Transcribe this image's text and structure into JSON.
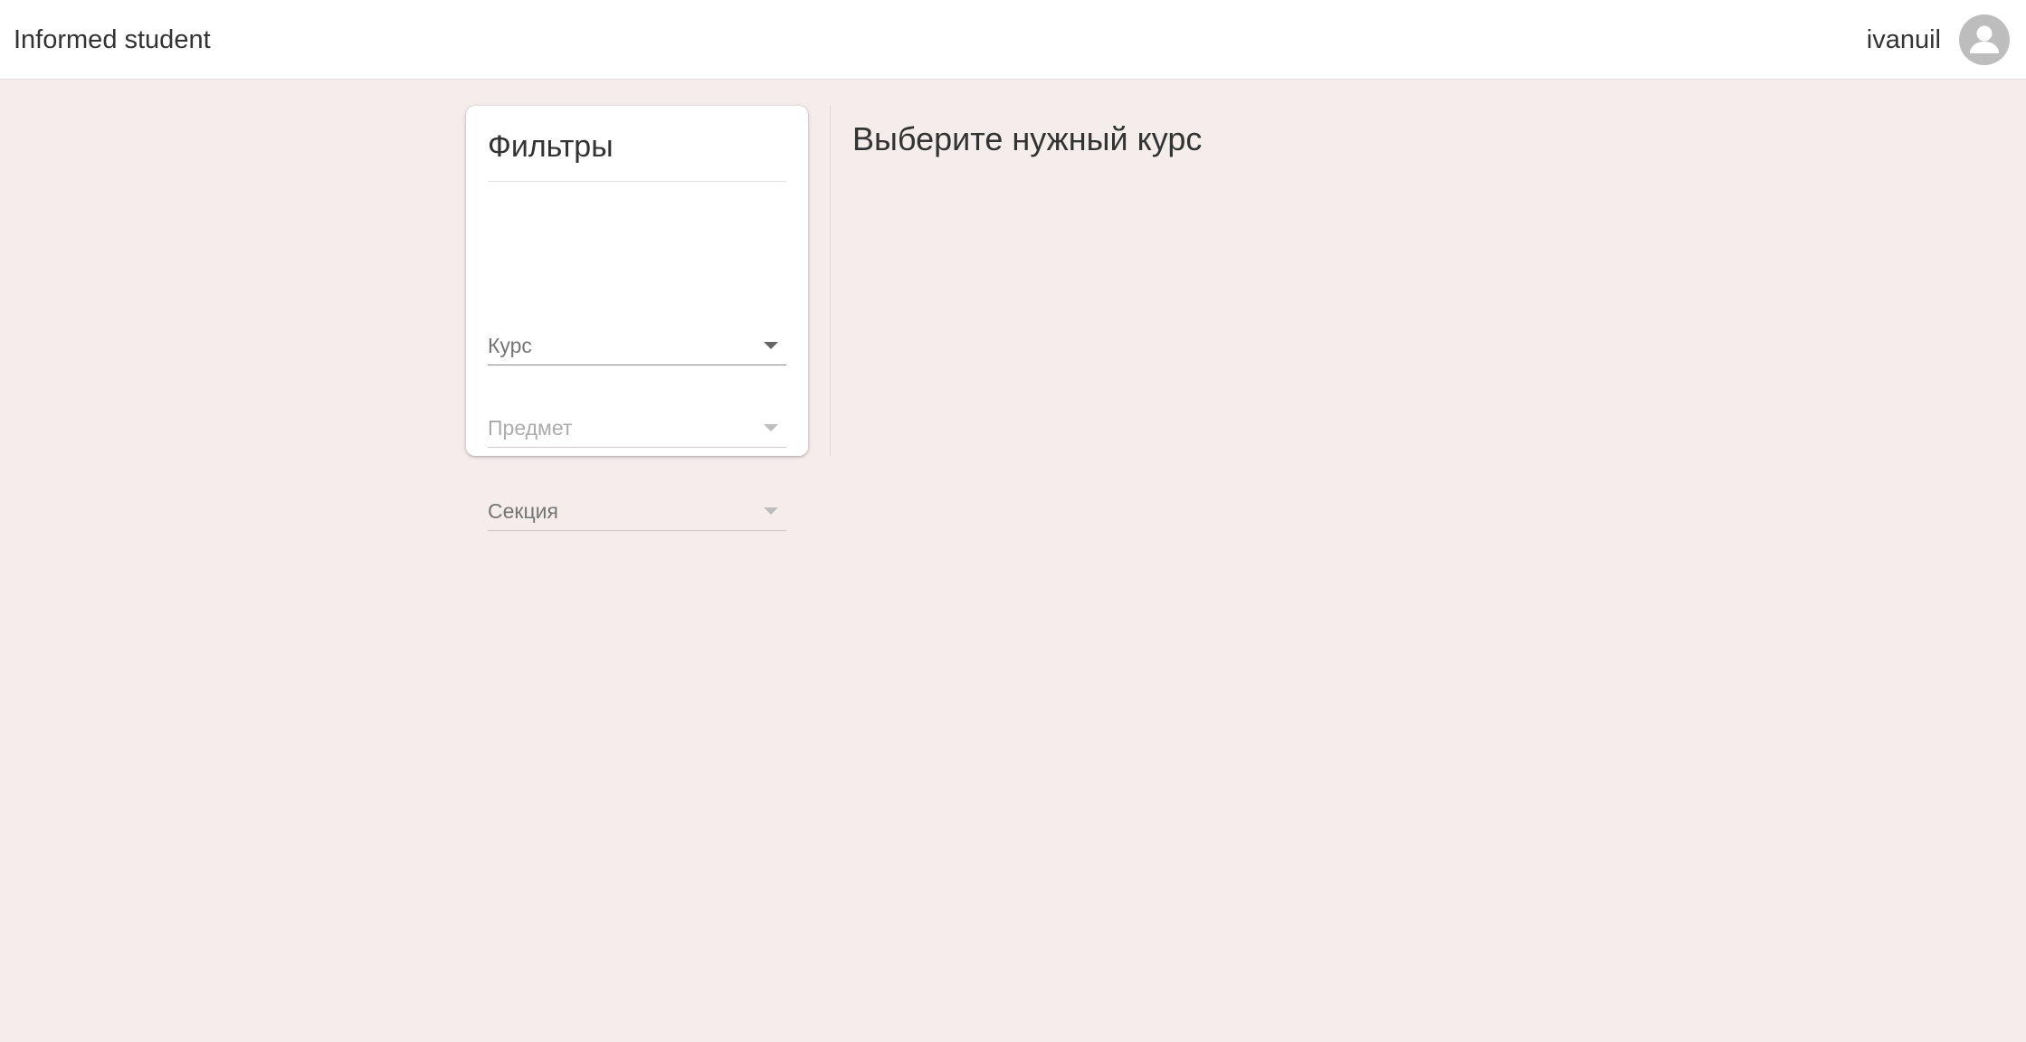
{
  "header": {
    "app_title": "Informed student",
    "username": "ivanuil",
    "avatar_icon": "account-circle-icon"
  },
  "filters": {
    "title": "Фильтры",
    "course": {
      "label": "Курс",
      "selected": "",
      "enabled": true
    },
    "subject": {
      "label": "Предмет",
      "selected": "",
      "enabled": false
    },
    "section": {
      "label": "Секция",
      "selected": "",
      "enabled": true
    }
  },
  "main": {
    "heading": "Выберите нужный курс"
  },
  "colors": {
    "background": "#f5ecec",
    "card": "#ffffff",
    "text": "#333333",
    "avatar": "#bdbdbd"
  }
}
